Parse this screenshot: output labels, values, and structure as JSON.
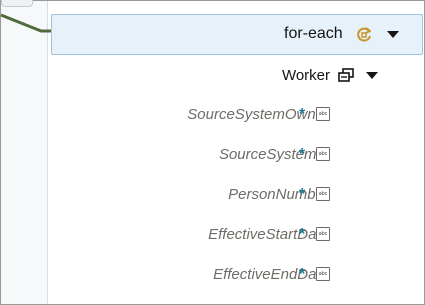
{
  "foreach": {
    "label": "for-each"
  },
  "worker": {
    "label": "Worker"
  },
  "fields": [
    {
      "name": "SourceSystemOwner",
      "required": "*",
      "type_icon": "abc"
    },
    {
      "name": "SourceSystemId",
      "required": "*",
      "type_icon": "abc"
    },
    {
      "name": "PersonNumber",
      "required": "*",
      "type_icon": "abc"
    },
    {
      "name": "EffectiveStartDate",
      "required": "*",
      "type_icon": "abc"
    },
    {
      "name": "EffectiveEndDate",
      "required": "*",
      "type_icon": "abc"
    }
  ],
  "icons": {
    "loop": "loop-refresh-icon",
    "collection": "collection-icon",
    "type": "string-type-icon",
    "caret": "caret-down-icon"
  },
  "colors": {
    "connector": "#4f6b3b",
    "node_background": "#e6f1fa",
    "node_border": "#9ec4df",
    "required_marker": "#1a7f93",
    "loop_icon": "#c8962a"
  }
}
